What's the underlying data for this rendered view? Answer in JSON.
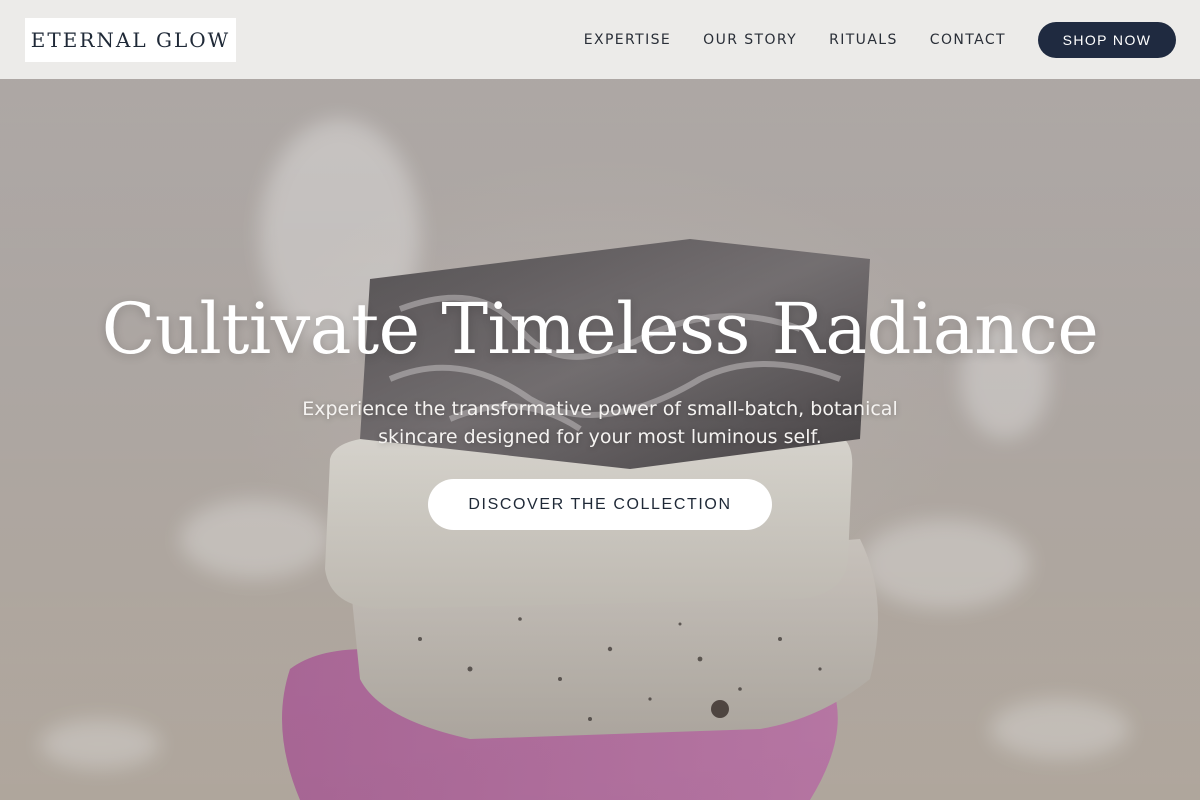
{
  "nav": {
    "logo": "ETERNAL GLOW",
    "links": [
      "EXPERTISE",
      "OUR STORY",
      "RITUALS",
      "CONTACT"
    ],
    "shop_label": "SHOP NOW"
  },
  "hero": {
    "title": "Cultivate Timeless Radiance",
    "subtitle": "Experience the transformative power of small-batch, botanical skincare designed for your most luminous self.",
    "cta_label": "DISCOVER THE COLLECTION",
    "image_subject": "stacked handmade soap bars"
  },
  "colors": {
    "nav_bg": "#ecebe9",
    "accent_button": "#1f2a40",
    "text_dark": "#1f2937"
  }
}
